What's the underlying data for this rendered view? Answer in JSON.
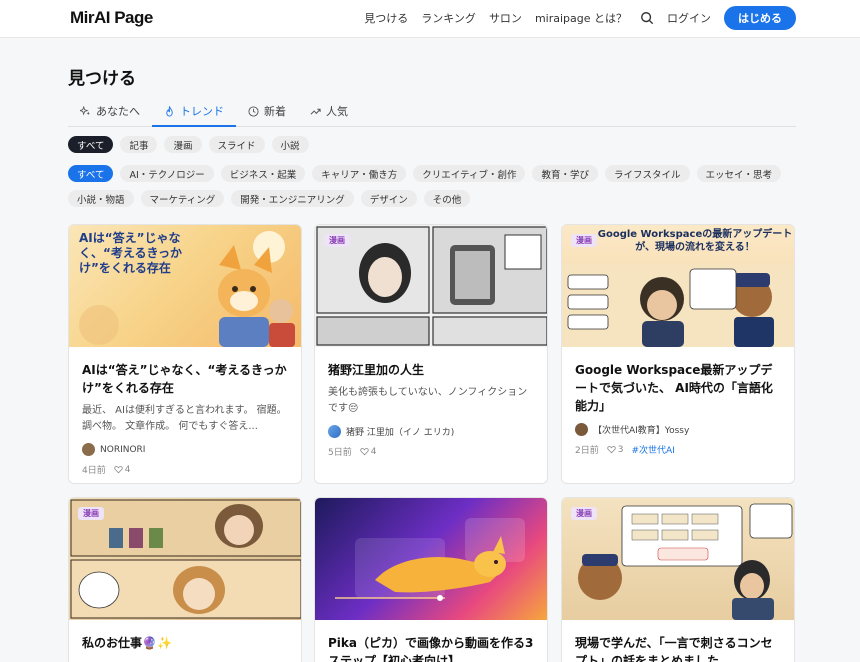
{
  "header": {
    "logo": "MirAI Page",
    "nav": [
      "見つける",
      "ランキング",
      "サロン",
      "miraipage とは？"
    ],
    "login": "ログイン",
    "start": "はじめる"
  },
  "page": {
    "title": "見つける"
  },
  "tabs": [
    {
      "label": "あなたへ",
      "icon": "sparkle-icon"
    },
    {
      "label": "トレンド",
      "icon": "flame-icon",
      "active": true
    },
    {
      "label": "新着",
      "icon": "clock-icon"
    },
    {
      "label": "人気",
      "icon": "trend-icon"
    }
  ],
  "type_chips": [
    "すべて",
    "記事",
    "漫画",
    "スライド",
    "小説"
  ],
  "category_chips": [
    "すべて",
    "AI・テクノロジー",
    "ビジネス・起業",
    "キャリア・働き方",
    "クリエイティブ・創作",
    "教育・学び",
    "ライフスタイル",
    "エッセイ・思考",
    "小説・物語",
    "マーケティング",
    "開発・エンジニアリング",
    "デザイン",
    "その他"
  ],
  "cards": [
    {
      "title": "AIは“答え”じゃなく、“考えるきっかけ”をくれる存在",
      "excerpt": "最近、 AIは便利すぎると言われます。 宿題。 調べ物。 文章作成。 何でもすぐ答え...",
      "author": "NORINORI",
      "date": "4日前",
      "likes": "4",
      "thumb_text": "AIは“答え”じゃなく、“考えるきっかけ”をくれる存在"
    },
    {
      "badge": "漫画",
      "title": "猪野江里加の人生",
      "excerpt": "美化も誇張もしていない、ノンフィクションです😔",
      "author": "猪野 江里加（イノ エリカ)",
      "date": "5日前",
      "likes": "4"
    },
    {
      "badge": "漫画",
      "title": "Google Workspace最新アップデートで気づいた、 AI時代の「言語化能力」",
      "author": "【次世代AI教育】Yossy",
      "date": "2日前",
      "likes": "3",
      "tag": "#次世代AI",
      "thumb_text": "Google Workspaceの最新アップデートが、現場の流れを変える！"
    },
    {
      "badge": "漫画",
      "title": "私のお仕事🔮✨"
    },
    {
      "title": "Pika（ピカ）で画像から動画を作る3ステップ【初心者向け】"
    },
    {
      "badge": "漫画",
      "title": "現場で学んだ、「一言で刺さるコンセプト」の話をまとめました。"
    }
  ],
  "colors": {
    "accent": "#1a73e8",
    "dark_chip": "#1b1f2a"
  }
}
